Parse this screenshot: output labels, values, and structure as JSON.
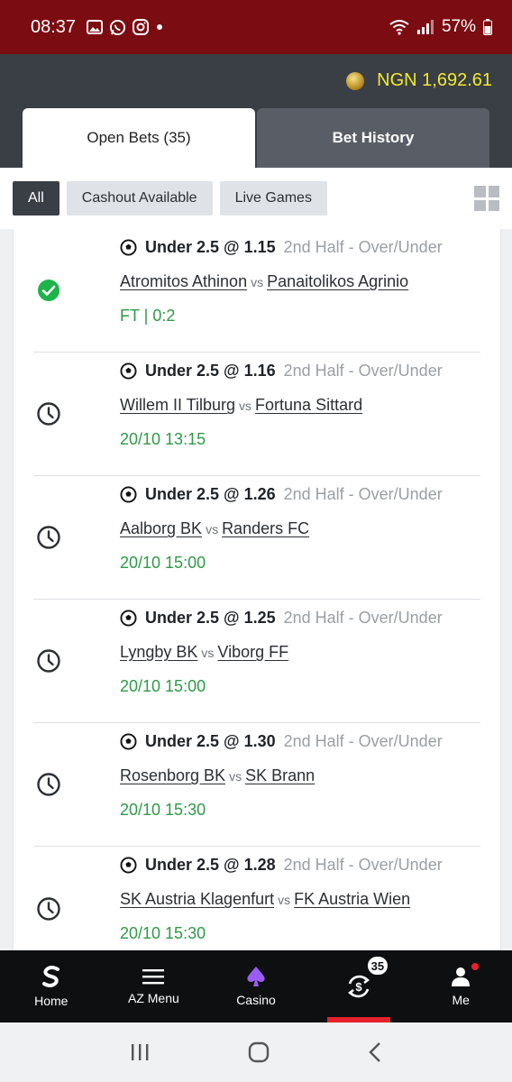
{
  "status_bar": {
    "time": "08:37",
    "battery": "57%"
  },
  "header": {
    "balance": "NGN 1,692.61"
  },
  "tabs": [
    {
      "label": "Open Bets (35)",
      "active": true
    },
    {
      "label": "Bet History",
      "active": false
    }
  ],
  "filters": [
    {
      "label": "All",
      "active": true
    },
    {
      "label": "Cashout Available",
      "active": false
    },
    {
      "label": "Live Games",
      "active": false
    }
  ],
  "bets": [
    {
      "status": "won",
      "selection": "Under 2.5 @ 1.15",
      "market": "2nd Half - Over/Under",
      "home": "Atromitos Athinon",
      "vs": "vs",
      "away": "Panaitolikos Agrinio",
      "info": "FT | 0:2"
    },
    {
      "status": "pending",
      "selection": "Under 2.5 @ 1.16",
      "market": "2nd Half - Over/Under",
      "home": "Willem II Tilburg",
      "vs": "vs",
      "away": "Fortuna Sittard",
      "info": "20/10 13:15"
    },
    {
      "status": "pending",
      "selection": "Under 2.5 @ 1.26",
      "market": "2nd Half - Over/Under",
      "home": "Aalborg BK",
      "vs": "vs",
      "away": "Randers FC",
      "info": "20/10 15:00"
    },
    {
      "status": "pending",
      "selection": "Under 2.5 @ 1.25",
      "market": "2nd Half - Over/Under",
      "home": "Lyngby BK",
      "vs": "vs",
      "away": "Viborg FF",
      "info": "20/10 15:00"
    },
    {
      "status": "pending",
      "selection": "Under 2.5 @ 1.30",
      "market": "2nd Half - Over/Under",
      "home": "Rosenborg BK",
      "vs": "vs",
      "away": "SK Brann",
      "info": "20/10 15:30"
    },
    {
      "status": "pending",
      "selection": "Under 2.5 @ 1.28",
      "market": "2nd Half - Over/Under",
      "home": "SK Austria Klagenfurt",
      "vs": "vs",
      "away": "FK Austria Wien",
      "info": "20/10 15:30"
    }
  ],
  "bottom_nav": [
    {
      "label": "Home",
      "icon": "sportybet-logo-icon"
    },
    {
      "label": "AZ Menu",
      "icon": "hamburger-icon"
    },
    {
      "label": "Casino",
      "icon": "spade-icon"
    },
    {
      "label": "",
      "icon": "open-bets-icon",
      "badge": "35",
      "active": true
    },
    {
      "label": "Me",
      "icon": "user-icon",
      "notification": true
    }
  ],
  "colors": {
    "status_bar": "#7b0c12",
    "header": "#3a3e45",
    "balance": "#f2ea2c",
    "won": "#1db44a",
    "date": "#2e9a47",
    "active_indicator": "#e5222b"
  }
}
